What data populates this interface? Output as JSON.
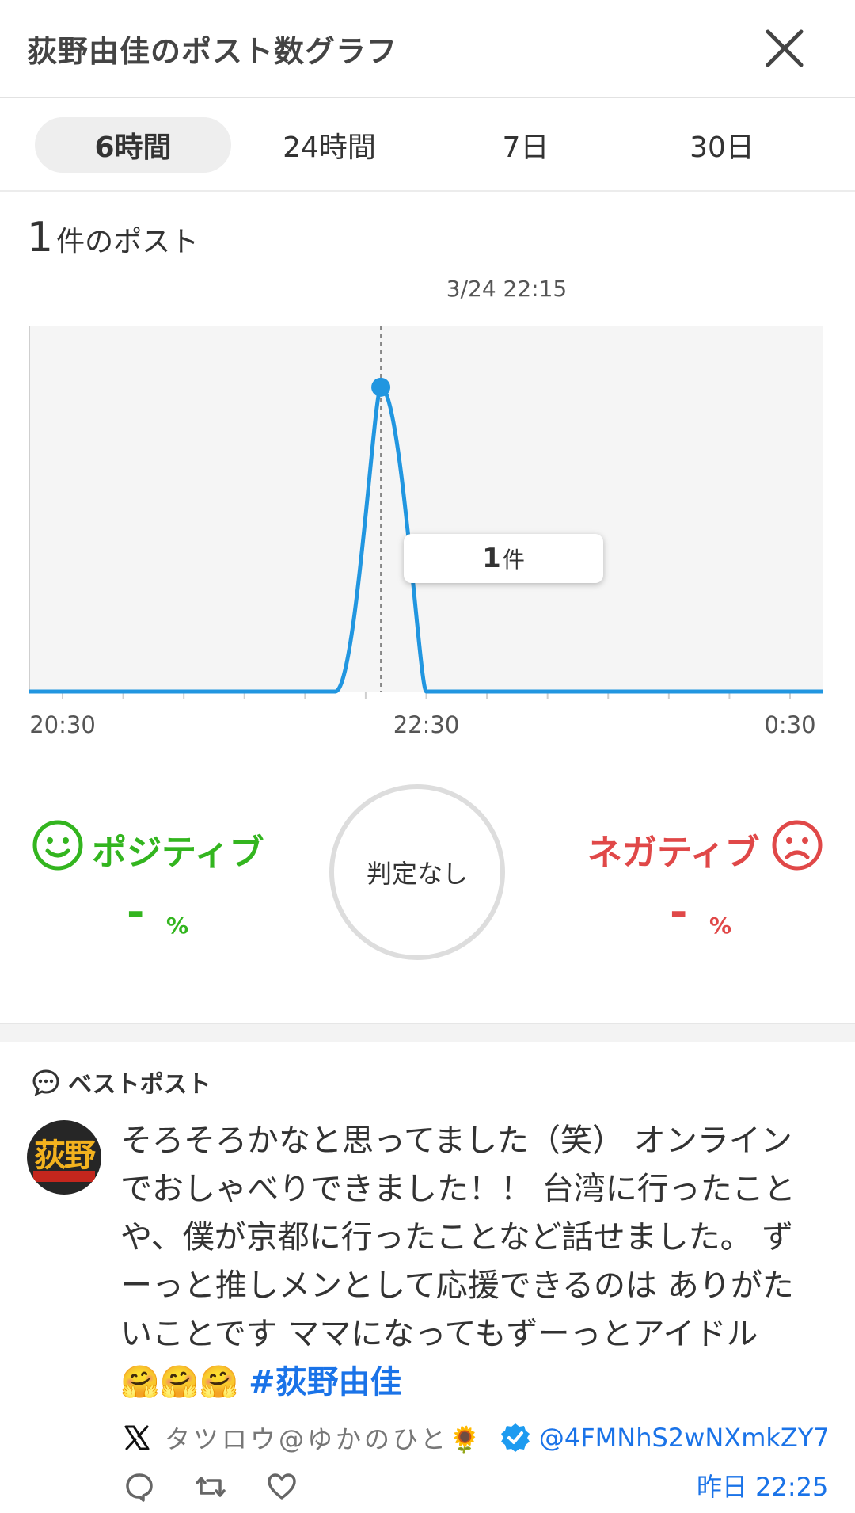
{
  "header": {
    "title": "荻野由佳のポスト数グラフ",
    "close_icon": "close-icon"
  },
  "tabs": [
    {
      "label": "6時間",
      "active": true
    },
    {
      "label": "24時間",
      "active": false
    },
    {
      "label": "7日",
      "active": false
    },
    {
      "label": "30日",
      "active": false
    }
  ],
  "summary": {
    "count": "1",
    "count_label": "件のポスト"
  },
  "chart_hover": {
    "date": "3/24 22:15",
    "tooltip_value": "1",
    "tooltip_unit": "件"
  },
  "chart_data": {
    "type": "line",
    "x_tick_labels": [
      "20:30",
      "22:30",
      "0:30"
    ],
    "x": [
      "20:30",
      "20:45",
      "21:00",
      "21:15",
      "21:30",
      "21:45",
      "22:00",
      "22:15",
      "22:30",
      "22:45",
      "23:00",
      "23:15",
      "23:30",
      "23:45",
      "0:00",
      "0:15",
      "0:30"
    ],
    "values": [
      0,
      0,
      0,
      0,
      0,
      0,
      0,
      1,
      0,
      0,
      0,
      0,
      0,
      0,
      0,
      0,
      0
    ],
    "highlight": {
      "x": "22:15",
      "value": 1
    },
    "line_color": "#2196e0",
    "background": "#f5f5f5",
    "grid": false
  },
  "sentiment": {
    "positive_label": "ポジティブ",
    "positive_value": "-",
    "positive_unit": "%",
    "positive_color": "#33b51f",
    "negative_label": "ネガティブ",
    "negative_value": "-",
    "negative_unit": "%",
    "negative_color": "#e04848",
    "center_label": "判定なし"
  },
  "best_post": {
    "section_title": "ベストポスト",
    "avatar_text": "荻野",
    "body": "そろそろかなと思ってました（笑） オンラインでおしゃべりできました！！ 台湾に行ったことや、僕が京都に行ったことなど話せました。 ずーっと推しメンとして応援できるのは ありがたいことです ママになってもずーっとアイドル 🤗🤗🤗 ",
    "hashtag": "#荻野由佳",
    "author": "タツロウ@ゆかのひと🌻",
    "handle": "@4FMNhS2wNXmkZY7",
    "time": "昨日 22:25"
  }
}
